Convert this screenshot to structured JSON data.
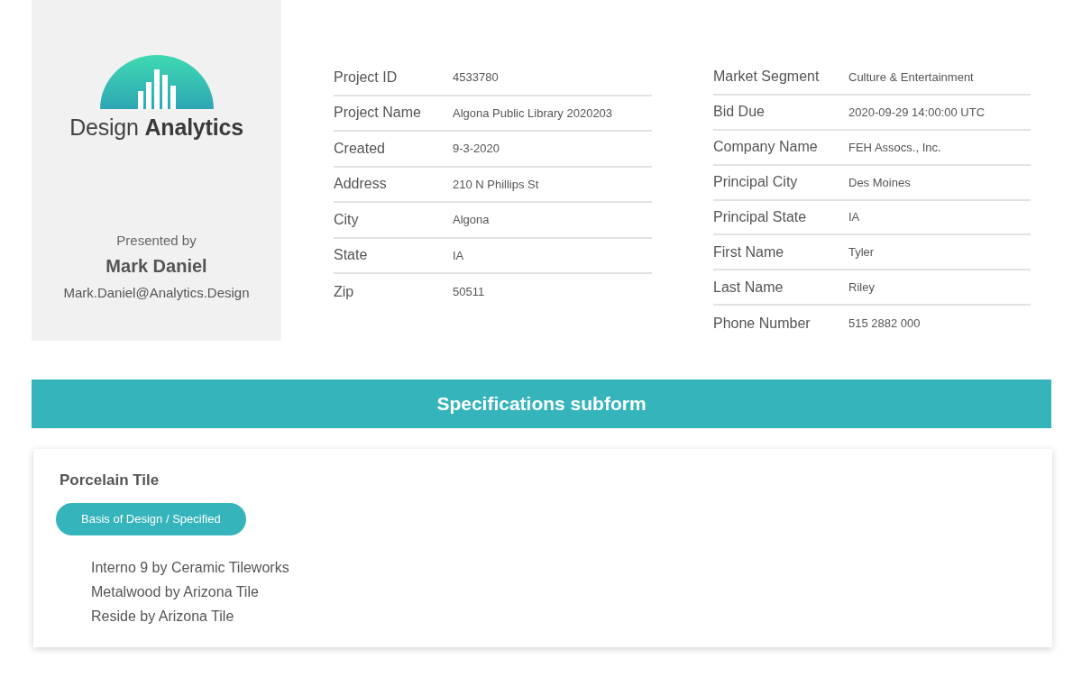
{
  "brand": {
    "name_light": "Design",
    "name_bold": "Analytics"
  },
  "presenter": {
    "caption": "Presented by",
    "name": "Mark Daniel",
    "email": "Mark.Daniel@Analytics.Design"
  },
  "fields_left": [
    {
      "label": "Project ID",
      "value": "4533780"
    },
    {
      "label": "Project Name",
      "value": "Algona Public Library 2020203"
    },
    {
      "label": "Created",
      "value": "9-3-2020"
    },
    {
      "label": "Address",
      "value": "210 N Phillips St"
    },
    {
      "label": "City",
      "value": "Algona"
    },
    {
      "label": "State",
      "value": "IA"
    },
    {
      "label": "Zip",
      "value": "50511"
    }
  ],
  "fields_right": [
    {
      "label": "Market Segment",
      "value": "Culture & Entertainment"
    },
    {
      "label": "Bid Due",
      "value": "2020-09-29 14:00:00 UTC"
    },
    {
      "label": "Company Name",
      "value": "FEH Assocs., Inc."
    },
    {
      "label": "Principal City",
      "value": "Des Moines"
    },
    {
      "label": "Principal State",
      "value": "IA"
    },
    {
      "label": "First Name",
      "value": "Tyler"
    },
    {
      "label": "Last Name",
      "value": "Riley"
    },
    {
      "label": "Phone Number",
      "value": "515 2882 000"
    }
  ],
  "subform": {
    "title": "Specifications subform"
  },
  "section": {
    "title": "Porcelain Tile",
    "tag": "Basis of Design / Specified",
    "items": [
      "Interno 9 by Ceramic Tileworks",
      "Metalwood by Arizona Tile",
      "Reside by Arizona Tile"
    ]
  }
}
